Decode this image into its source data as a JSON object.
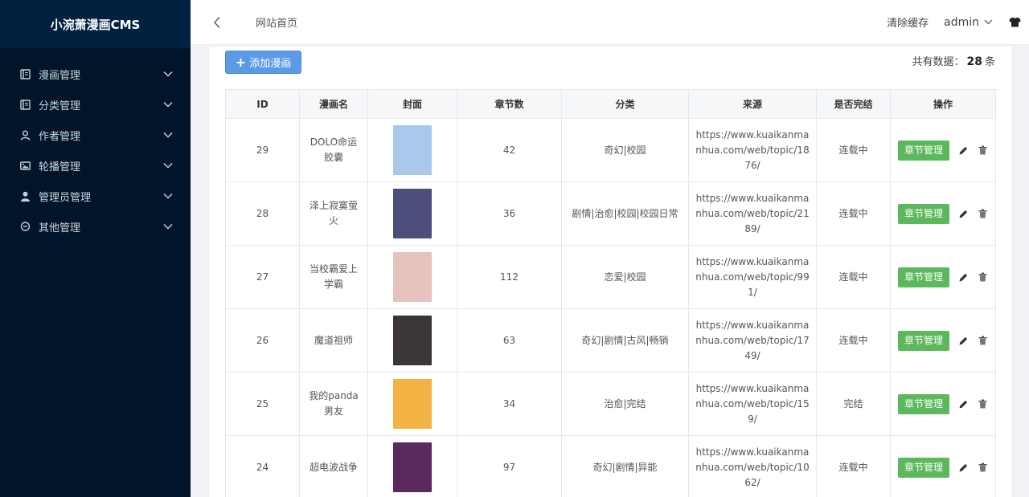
{
  "app": {
    "logo": "小涴萧漫画CMS"
  },
  "sidebar": {
    "items": [
      {
        "label": "漫画管理",
        "icon": "book-icon"
      },
      {
        "label": "分类管理",
        "icon": "book-icon"
      },
      {
        "label": "作者管理",
        "icon": "user-outline-icon"
      },
      {
        "label": "轮播管理",
        "icon": "image-icon"
      },
      {
        "label": "管理员管理",
        "icon": "user-solid-icon"
      },
      {
        "label": "其他管理",
        "icon": "chat-icon"
      }
    ]
  },
  "header": {
    "breadcrumb": "网站首页",
    "clear_cache": "清除缓存",
    "user": "admin"
  },
  "toolbar": {
    "add_label": "添加漫画",
    "total_prefix": "共有数据：",
    "total_count": "28",
    "total_suffix": "条"
  },
  "table": {
    "columns": [
      "ID",
      "漫画名",
      "封面",
      "章节数",
      "分类",
      "来源",
      "是否完结",
      "操作"
    ],
    "action_label": "章节管理",
    "rows": [
      {
        "id": "29",
        "name": "DOLO命运胶囊",
        "chapters": "42",
        "category": "奇幻|校园",
        "source": "https://www.kuaikanmanhua.com/web/topic/1876/",
        "status": "连载中",
        "cover_color": "#a9c8ea"
      },
      {
        "id": "28",
        "name": "泽上寂寞萤火",
        "chapters": "36",
        "category": "剧情|治愈|校园|校园日常",
        "source": "https://www.kuaikanmanhua.com/web/topic/2189/",
        "status": "连载中",
        "cover_color": "#4c4f7a"
      },
      {
        "id": "27",
        "name": "当校霸爱上学霸",
        "chapters": "112",
        "category": "恋爱|校园",
        "source": "https://www.kuaikanmanhua.com/web/topic/991/",
        "status": "连载中",
        "cover_color": "#e6c3bd"
      },
      {
        "id": "26",
        "name": "魔道祖师",
        "chapters": "63",
        "category": "奇幻|剧情|古风|畅销",
        "source": "https://www.kuaikanmanhua.com/web/topic/1749/",
        "status": "连载中",
        "cover_color": "#3b3438"
      },
      {
        "id": "25",
        "name": "我的panda男友",
        "chapters": "34",
        "category": "治愈|完结",
        "source": "https://www.kuaikanmanhua.com/web/topic/159/",
        "status": "完结",
        "cover_color": "#f2b342"
      },
      {
        "id": "24",
        "name": "超电波战争",
        "chapters": "97",
        "category": "奇幻|剧情|异能",
        "source": "https://www.kuaikanmanhua.com/web/topic/1062/",
        "status": "连载中",
        "cover_color": "#5a2a5e"
      }
    ]
  },
  "colors": {
    "sidebar_bg": "#001529",
    "primary": "#5b9be6",
    "success": "#5cb85c"
  }
}
